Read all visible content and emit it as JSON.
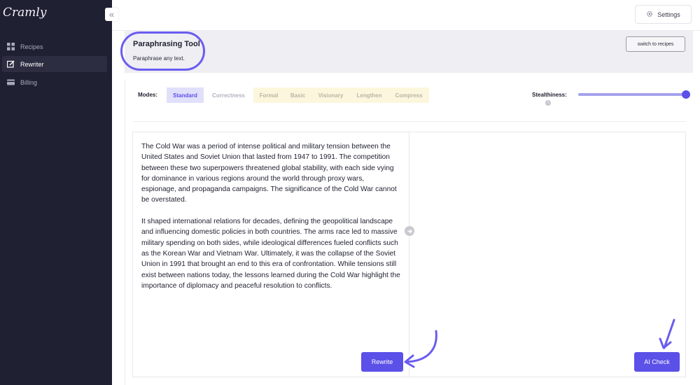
{
  "app": {
    "logo": "Cramly",
    "collapse_glyph": "«"
  },
  "sidebar": {
    "items": [
      {
        "label": "Recipes",
        "icon": "grid-icon",
        "active": false
      },
      {
        "label": "Rewriter",
        "icon": "edit-icon",
        "active": true
      },
      {
        "label": "Billing",
        "icon": "card-icon",
        "active": false
      }
    ]
  },
  "topbar": {
    "settings_label": "Settings",
    "settings_icon": "gear-icon"
  },
  "header": {
    "title": "Paraphrasing Tool",
    "subtitle": "Paraphrase any text.",
    "switch_label": "switch to recipes"
  },
  "modes": {
    "label": "Modes:",
    "items": [
      "Standard",
      "Correctness",
      "Formal",
      "Basic",
      "Visionary",
      "Lengthen",
      "Compress"
    ],
    "selected": "Standard"
  },
  "stealth": {
    "label": "Stealthiness:",
    "info_glyph": "i",
    "value": 1.0
  },
  "editor": {
    "paragraphs": [
      "The Cold War was a period of intense political and military tension between the United States and Soviet Union that lasted from 1947 to 1991. The competition between these two superpowers threatened global stability, with each side vying for dominance in various regions around the world through proxy wars, espionage, and propaganda campaigns. The significance of the Cold War cannot be overstated.",
      "It shaped international relations for decades, defining the geopolitical landscape and influencing domestic policies in both countries. The arms race led to massive military spending on both sides, while ideological differences fueled conflicts such as the Korean War and Vietnam War. Ultimately, it was the collapse of the Soviet Union in 1991 that brought an end to this era of confrontation. While tensions still exist between nations today, the lessons learned during the Cold War highlight the importance of diplomacy and peaceful resolution to conflicts."
    ],
    "output": ""
  },
  "actions": {
    "rewrite_label": "Rewrite",
    "aicheck_label": "AI Check"
  },
  "colors": {
    "accent": "#5b50e8",
    "annotation": "#6a5cf0",
    "sidebar_bg": "#1f2032"
  }
}
